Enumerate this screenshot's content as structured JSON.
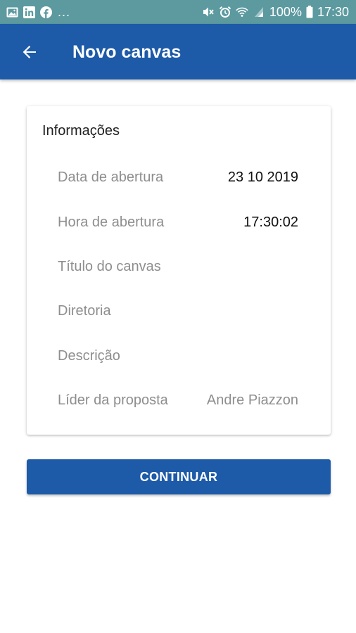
{
  "status_bar": {
    "left_icons": [
      "gallery-icon",
      "linkedin-icon",
      "facebook-icon"
    ],
    "overflow": "...",
    "right_icons": [
      "mute-icon",
      "alarm-icon",
      "wifi-icon",
      "signal-icon"
    ],
    "battery_percent": "100%",
    "time": "17:30",
    "background_color": "#5c9aa0"
  },
  "app_bar": {
    "back_icon": "arrow-left-icon",
    "title": "Novo canvas",
    "background_color": "#1d5aa8"
  },
  "card": {
    "title": "Informações",
    "rows": [
      {
        "label": "Data de abertura",
        "value": "23 10 2019"
      },
      {
        "label": "Hora de abertura",
        "value": "17:30:02"
      },
      {
        "label": "Título do canvas",
        "value": ""
      },
      {
        "label": "Diretoria",
        "value": ""
      },
      {
        "label": "Descrição",
        "value": ""
      },
      {
        "label": "Líder da proposta",
        "value": "Andre Piazzon"
      }
    ]
  },
  "actions": {
    "continue_label": "CONTINUAR",
    "accent_color": "#1d5aa8"
  }
}
